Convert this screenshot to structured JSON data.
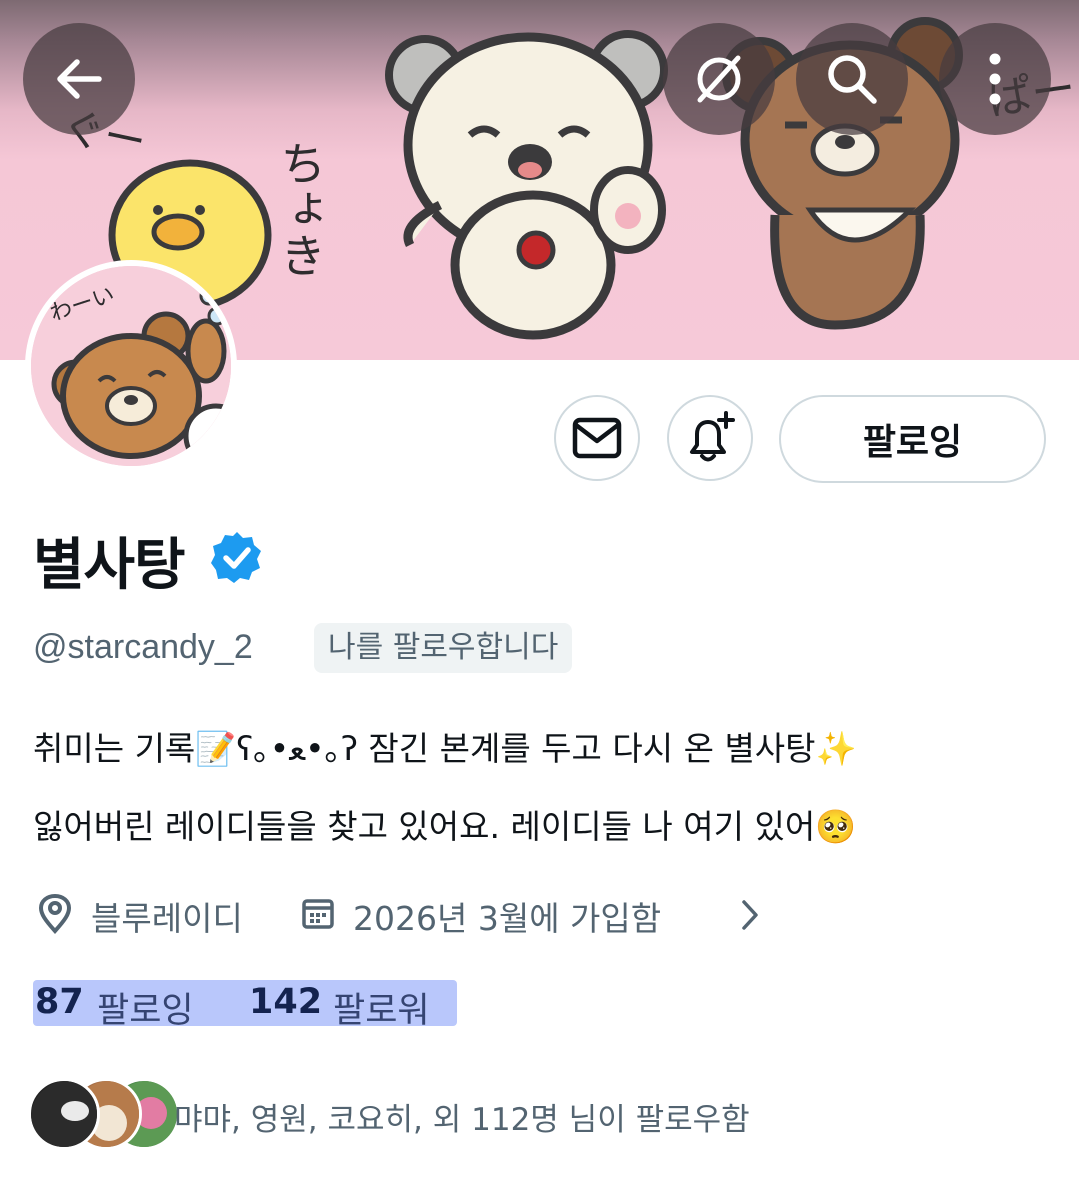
{
  "profile": {
    "display_name": "별사탕",
    "handle": "@starcandy_2",
    "follows_you_badge": "나를 팔로우합니다",
    "bio_line1": "취미는 기록📝ʕ｡•ﻌ•｡ʔ 잠긴 본계를 두고 다시 온 별사탕✨",
    "bio_line2": "잃어버린 레이디들을 찾고 있어요.  레이디들 나 여기 있어🥺",
    "location": "블루레이디",
    "joined": "2026년 3월에 가입함",
    "following_count": "87",
    "following_label": "팔로잉",
    "followers_count": "142",
    "followers_label": "팔로워",
    "followed_by_text": "먀먀, 영원, 코요히, 외 112명 님이 팔로우함"
  },
  "actions": {
    "follow_button_label": "팔로잉"
  },
  "banner": {
    "text_ku": "ぐー",
    "text_choki": "ちょき",
    "text_pa": "ぱー"
  },
  "avatar": {
    "text_wai": "わーい"
  },
  "icons": {
    "back": "back-arrow-icon",
    "grok": "grok-icon",
    "search": "search-icon",
    "more": "more-vertical-icon",
    "message": "envelope-icon",
    "notify": "bell-plus-icon",
    "verified": "verified-badge-icon",
    "location": "location-pin-icon",
    "calendar": "calendar-icon",
    "chevron": "chevron-right-icon"
  },
  "colors": {
    "verified_blue": "#1d9bf0",
    "secondary_text": "#536471",
    "highlight": "#b9c7fb",
    "banner_pink": "#f6c9d8"
  }
}
